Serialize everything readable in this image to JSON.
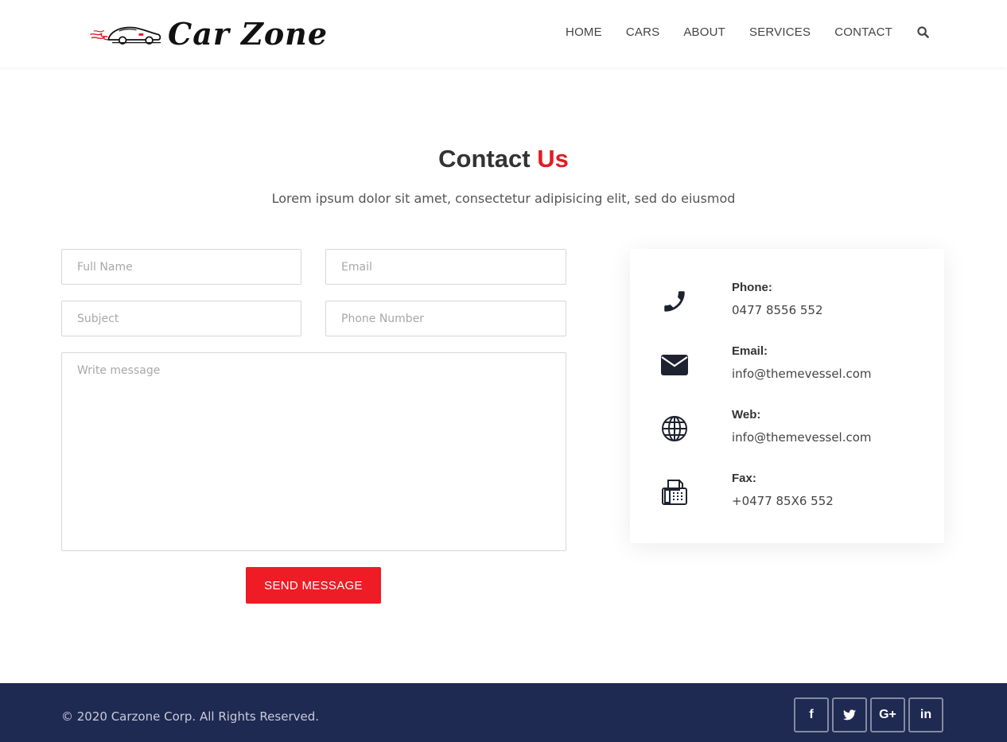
{
  "header": {
    "logo_text": "Car Zone",
    "nav": [
      "HOME",
      "CARS",
      "ABOUT",
      "SERVICES",
      "CONTACT"
    ],
    "search_icon": "search-icon"
  },
  "section": {
    "title_main": "Contact",
    "title_accent": "Us",
    "subtitle": "Lorem ipsum dolor sit amet, consectetur adipisicing elit, sed do eiusmod"
  },
  "form": {
    "full_name_placeholder": "Full Name",
    "email_placeholder": "Email",
    "subject_placeholder": "Subject",
    "phone_placeholder": "Phone Number",
    "message_placeholder": "Write message",
    "send_label": "SEND MESSAGE"
  },
  "contact_info": [
    {
      "icon": "phone-icon",
      "label": "Phone:",
      "value": "0477 8556 552"
    },
    {
      "icon": "envelope-icon",
      "label": "Email:",
      "value": "info@themevessel.com"
    },
    {
      "icon": "globe-icon",
      "label": "Web:",
      "value": "info@themevessel.com"
    },
    {
      "icon": "fax-icon",
      "label": "Fax:",
      "value": "+0477 85X6 552"
    }
  ],
  "footer": {
    "copyright": "© 2020 Carzone Corp. All Rights Reserved.",
    "social": [
      {
        "icon": "facebook-icon",
        "glyph": "f"
      },
      {
        "icon": "twitter-icon",
        "glyph": "t"
      },
      {
        "icon": "google-plus-icon",
        "glyph": "G+"
      },
      {
        "icon": "linkedin-icon",
        "glyph": "in"
      }
    ]
  },
  "colors": {
    "accent": "#ee1c25",
    "footer_bg": "#1f2a52",
    "text": "#333333"
  }
}
